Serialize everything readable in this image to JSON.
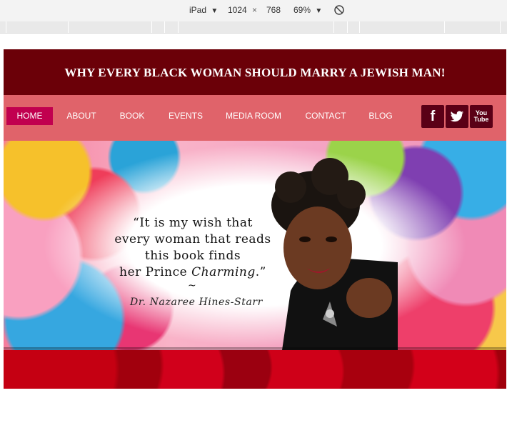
{
  "devtools": {
    "device": "iPad",
    "width": "1024",
    "times": "×",
    "height": "768",
    "zoom": "69%"
  },
  "site": {
    "title": "WHY EVERY BLACK WOMAN SHOULD MARRY A JEWISH MAN!"
  },
  "nav": {
    "items": [
      {
        "label": "HOME",
        "active": true
      },
      {
        "label": "ABOUT"
      },
      {
        "label": "BOOK"
      },
      {
        "label": "EVENTS"
      },
      {
        "label": "MEDIA ROOM"
      },
      {
        "label": "CONTACT"
      },
      {
        "label": "BLOG"
      }
    ],
    "social": [
      {
        "icon": "facebook-icon",
        "glyph": "f"
      },
      {
        "icon": "twitter-icon"
      },
      {
        "icon": "youtube-icon",
        "line1": "You",
        "line2": "Tube"
      }
    ]
  },
  "hero": {
    "quote_line1": "“It is my wish that",
    "quote_line2": "every woman that reads",
    "quote_line3": "this book finds",
    "quote_line4_a": "her Prince ",
    "quote_line4_b": "Charming",
    "quote_line4_c": ".”",
    "tilde": "~",
    "author": "Dr. Nazaree Hines-Starr"
  },
  "colors": {
    "header_bg": "#6b0008",
    "nav_bg": "#e0636a",
    "nav_active": "#c1004f",
    "social_bg": "#5a0016"
  }
}
